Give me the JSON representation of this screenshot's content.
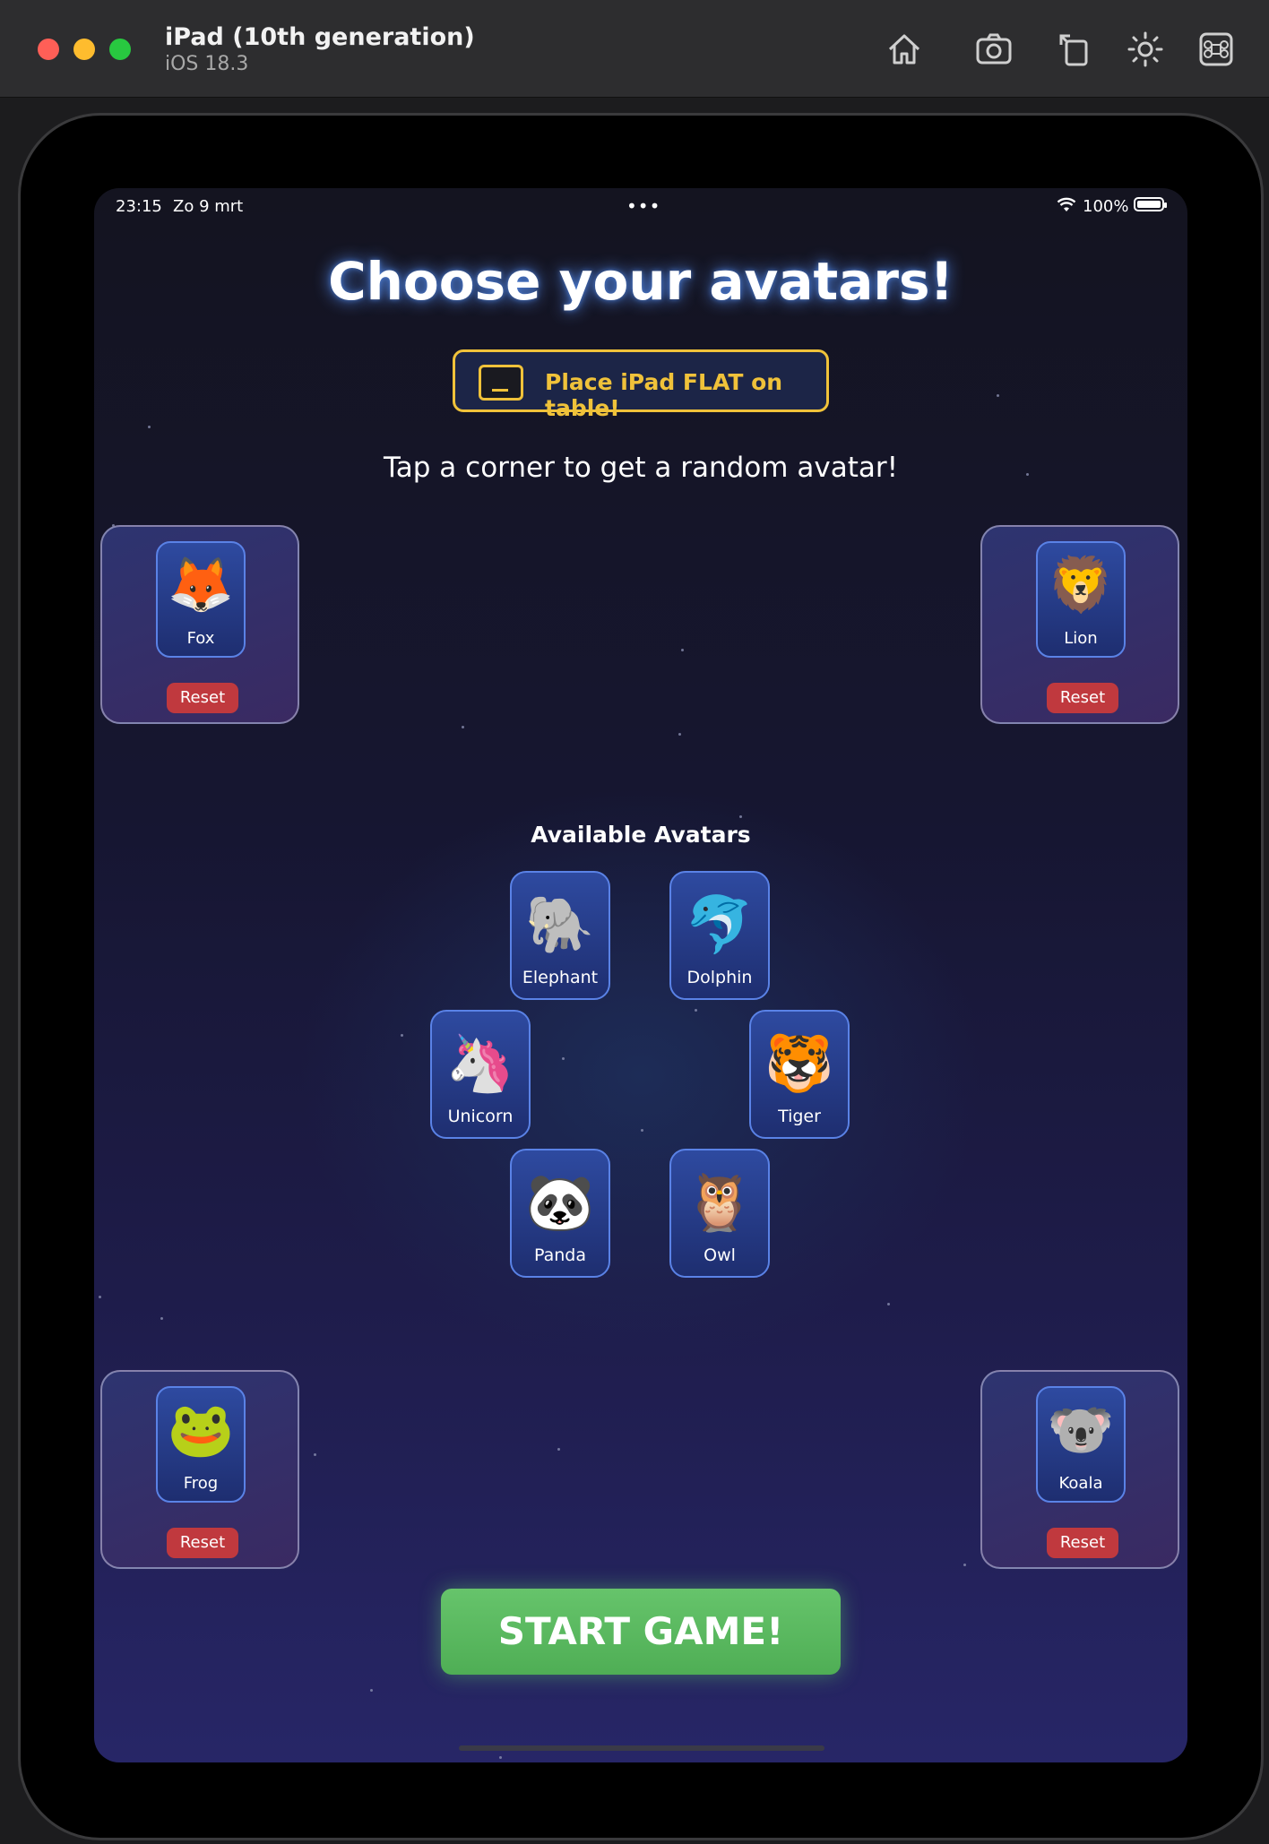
{
  "window": {
    "title": "iPad (10th generation)",
    "subtitle": "iOS 18.3",
    "toolbar_icons": [
      "home-icon",
      "screenshot-icon",
      "rotate-icon",
      "brightness-icon",
      "command-icon"
    ]
  },
  "status_bar": {
    "time": "23:15",
    "date": "Zo 9 mrt",
    "dots": "•••",
    "battery": "100%"
  },
  "header": {
    "title": "Choose your avatars!",
    "warning": "Place iPad FLAT on table!",
    "instruction": "Tap a corner to get a random avatar!"
  },
  "corners": {
    "top_left": {
      "emoji": "🦊",
      "name": "Fox",
      "reset": "Reset"
    },
    "top_right": {
      "emoji": "🦁",
      "name": "Lion",
      "reset": "Reset"
    },
    "bottom_left": {
      "emoji": "🐸",
      "name": "Frog",
      "reset": "Reset"
    },
    "bottom_right": {
      "emoji": "🐨",
      "name": "Koala",
      "reset": "Reset"
    }
  },
  "pool": {
    "title": "Available Avatars",
    "avatars": [
      {
        "emoji": "🐘",
        "name": "Elephant"
      },
      {
        "emoji": "🐬",
        "name": "Dolphin"
      },
      {
        "emoji": "🦄",
        "name": "Unicorn"
      },
      {
        "emoji": "🐯",
        "name": "Tiger"
      },
      {
        "emoji": "🐼",
        "name": "Panda"
      },
      {
        "emoji": "🦉",
        "name": "Owl"
      }
    ]
  },
  "start_button": "START GAME!",
  "colors": {
    "accent_yellow": "#f0c23a",
    "reset_red": "#c0393e",
    "start_green": "#5dbb62",
    "avatar_blue": "#2e4aa0"
  }
}
